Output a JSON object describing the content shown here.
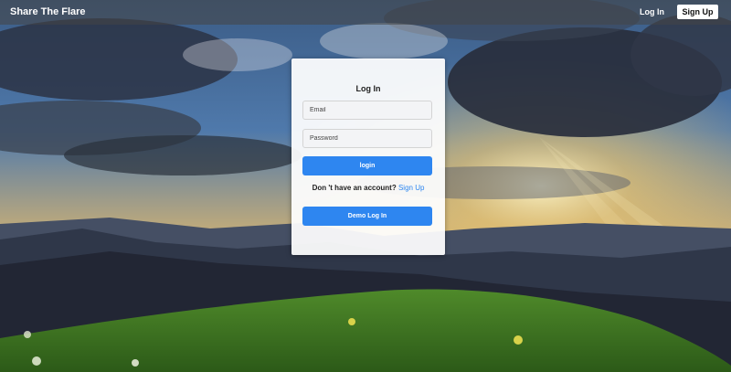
{
  "navbar": {
    "brand": "Share The Flare",
    "login_label": "Log In",
    "signup_label": "Sign Up"
  },
  "login_card": {
    "title": "Log In",
    "email_placeholder": "Email",
    "password_placeholder": "Password",
    "login_button": "login",
    "no_account_text": "Don 't have an account?",
    "signup_link": "Sign Up",
    "demo_button": "Demo Log In"
  },
  "colors": {
    "accent": "#2e86f0",
    "navbar": "#464646"
  }
}
